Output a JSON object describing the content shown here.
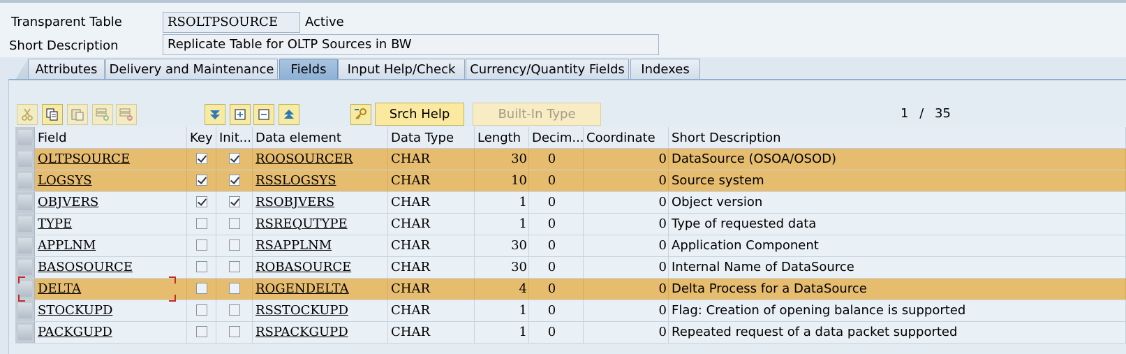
{
  "header": {
    "type_label": "Transparent Table",
    "table_name": "RSOLTPSOURCE",
    "status": "Active",
    "short_desc_label": "Short Description",
    "short_desc_value": "Replicate Table for OLTP Sources in BW"
  },
  "tabs": [
    {
      "label": "Attributes",
      "active": false
    },
    {
      "label": "Delivery and Maintenance",
      "active": false
    },
    {
      "label": "Fields",
      "active": true
    },
    {
      "label": "Input Help/Check",
      "active": false
    },
    {
      "label": "Currency/Quantity Fields",
      "active": false
    },
    {
      "label": "Indexes",
      "active": false
    }
  ],
  "toolbar": {
    "icons": [
      "cut-icon",
      "copy-icon",
      "paste-icon",
      "insert-row-icon",
      "delete-row-icon",
      "move-down-icon",
      "insert-field-icon",
      "delete-field-icon",
      "move-up-icon",
      "key-icon"
    ],
    "srch_help_label": "Srch Help",
    "builtin_type_label": "Built-In Type",
    "pager_current": "1",
    "pager_sep": "/",
    "pager_total": "35"
  },
  "columns": [
    "Field",
    "Key",
    "Init...",
    "Data element",
    "Data Type",
    "Length",
    "Decim...",
    "Coordinate",
    "Short Description"
  ],
  "rows": [
    {
      "field": "OLTPSOURCE",
      "key": true,
      "init": true,
      "data_element": "ROOSOURCER",
      "data_type": "CHAR",
      "length": "30",
      "decimals": "0",
      "coordinate": "0",
      "desc": "DataSource (OSOA/OSOD)",
      "highlight": true
    },
    {
      "field": "LOGSYS",
      "key": true,
      "init": true,
      "data_element": "RSSLOGSYS",
      "data_type": "CHAR",
      "length": "10",
      "decimals": "0",
      "coordinate": "0",
      "desc": "Source system",
      "highlight": true
    },
    {
      "field": "OBJVERS",
      "key": true,
      "init": true,
      "data_element": "RSOBJVERS",
      "data_type": "CHAR",
      "length": "1",
      "decimals": "0",
      "coordinate": "0",
      "desc": "Object version",
      "highlight": false
    },
    {
      "field": "TYPE",
      "key": false,
      "init": false,
      "data_element": "RSREQUTYPE",
      "data_type": "CHAR",
      "length": "1",
      "decimals": "0",
      "coordinate": "0",
      "desc": "Type of requested data",
      "highlight": false
    },
    {
      "field": "APPLNM",
      "key": false,
      "init": false,
      "data_element": "RSAPPLNM",
      "data_type": "CHAR",
      "length": "30",
      "decimals": "0",
      "coordinate": "0",
      "desc": "Application Component",
      "highlight": false
    },
    {
      "field": "BASOSOURCE",
      "key": false,
      "init": false,
      "data_element": "ROBASOURCE",
      "data_type": "CHAR",
      "length": "30",
      "decimals": "0",
      "coordinate": "0",
      "desc": "Internal Name of DataSource",
      "highlight": false
    },
    {
      "field": "DELTA",
      "key": false,
      "init": false,
      "data_element": "ROGENDELTA",
      "data_type": "CHAR",
      "length": "4",
      "decimals": "0",
      "coordinate": "0",
      "desc": "Delta Process for a DataSource",
      "highlight": true
    },
    {
      "field": "STOCKUPD",
      "key": false,
      "init": false,
      "data_element": "RSSTOCKUPD",
      "data_type": "CHAR",
      "length": "1",
      "decimals": "0",
      "coordinate": "0",
      "desc": "Flag: Creation of opening balance is supported",
      "highlight": false
    },
    {
      "field": "PACKGUPD",
      "key": false,
      "init": false,
      "data_element": "RSPACKGUPD",
      "data_type": "CHAR",
      "length": "1",
      "decimals": "0",
      "coordinate": "0",
      "desc": "Repeated request of a data packet supported",
      "highlight": false
    }
  ],
  "colors": {
    "highlight_row": "#e6bc6f",
    "active_tab": "#8db0d4",
    "button_yellow": "#f7eaa3"
  }
}
